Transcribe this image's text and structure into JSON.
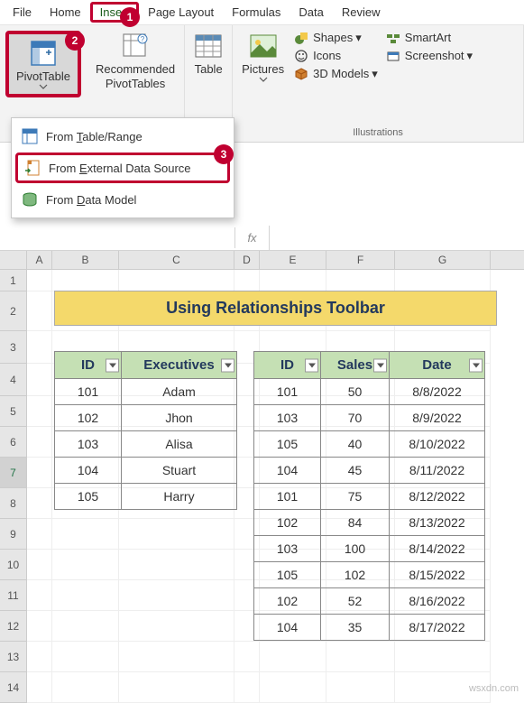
{
  "menu": {
    "file": "File",
    "home": "Home",
    "insert": "Insert",
    "pagelayout": "Page Layout",
    "formulas": "Formulas",
    "data": "Data",
    "review": "Review"
  },
  "ribbon": {
    "pivot": "PivotTable",
    "recpivot": "Recommended\nPivotTables",
    "table": "Table",
    "pictures": "Pictures",
    "shapes": "Shapes",
    "icons": "Icons",
    "models3d": "3D Models",
    "smartart": "SmartArt",
    "screenshot": "Screenshot",
    "illustrations": "Illustrations"
  },
  "dropdown": {
    "item1": "From Table/Range",
    "item2_pre": "From ",
    "item2_u": "E",
    "item2_post": "xternal Data Source",
    "item3_pre": "From ",
    "item3_u": "D",
    "item3_post": "ata Model"
  },
  "badges": {
    "b1": "1",
    "b2": "2",
    "b3": "3"
  },
  "fx": "fx",
  "cols": [
    "A",
    "B",
    "C",
    "D",
    "E",
    "F",
    "G"
  ],
  "rowcount": 14,
  "title": "Using Relationships Toolbar",
  "lefttable": {
    "headers": [
      "ID",
      "Executives"
    ],
    "rows": [
      [
        "101",
        "Adam"
      ],
      [
        "102",
        "Jhon"
      ],
      [
        "103",
        "Alisa"
      ],
      [
        "104",
        "Stuart"
      ],
      [
        "105",
        "Harry"
      ]
    ]
  },
  "righttable": {
    "headers": [
      "ID",
      "Sales",
      "Date"
    ],
    "rows": [
      [
        "101",
        "50",
        "8/8/2022"
      ],
      [
        "103",
        "70",
        "8/9/2022"
      ],
      [
        "105",
        "40",
        "8/10/2022"
      ],
      [
        "104",
        "45",
        "8/11/2022"
      ],
      [
        "101",
        "75",
        "8/12/2022"
      ],
      [
        "102",
        "84",
        "8/13/2022"
      ],
      [
        "103",
        "100",
        "8/14/2022"
      ],
      [
        "105",
        "102",
        "8/15/2022"
      ],
      [
        "102",
        "52",
        "8/16/2022"
      ],
      [
        "104",
        "35",
        "8/17/2022"
      ]
    ]
  },
  "watermark": "wsxdn.com"
}
